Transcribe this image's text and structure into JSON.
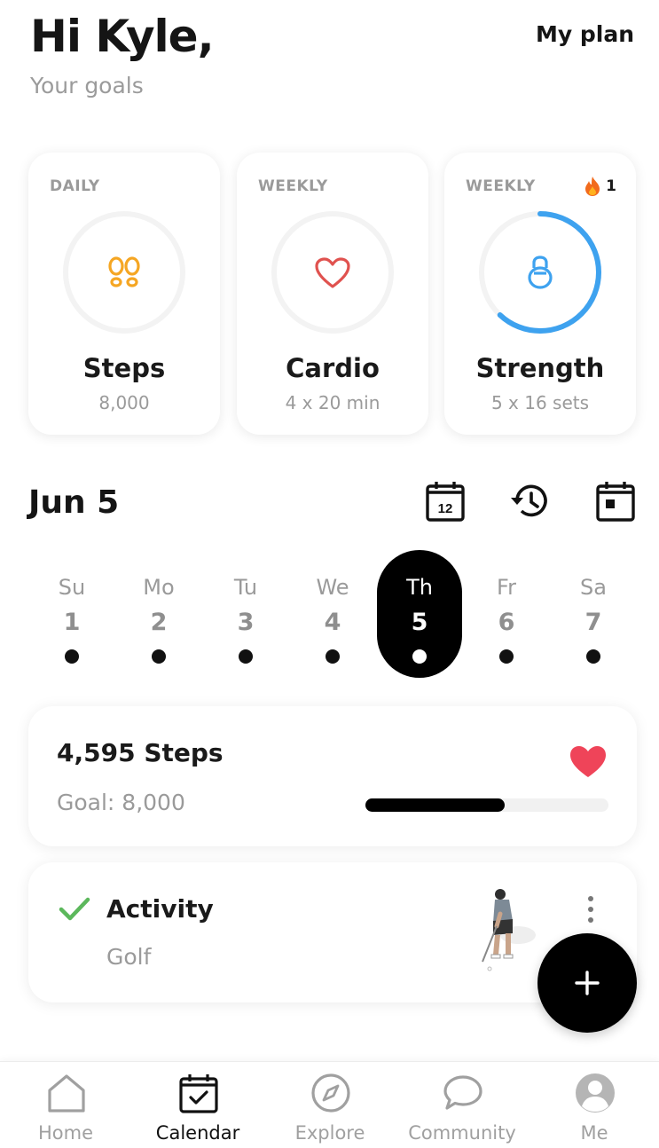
{
  "header": {
    "greeting": "Hi Kyle,",
    "subtitle": "Your goals",
    "my_plan_label": "My plan"
  },
  "goals": [
    {
      "period": "DAILY",
      "name": "Steps",
      "target": "8,000",
      "icon": "footprints-icon",
      "progress": 0
    },
    {
      "period": "WEEKLY",
      "name": "Cardio",
      "target": "4 x 20 min",
      "icon": "heart-icon",
      "progress": 0
    },
    {
      "period": "WEEKLY",
      "name": "Strength",
      "target": "5 x 16 sets",
      "icon": "kettlebell-icon",
      "progress": 0.62,
      "streak": "1"
    }
  ],
  "calendar": {
    "date_label": "Jun 5",
    "calendar_icon_number": "12",
    "days": [
      {
        "name": "Su",
        "num": "1"
      },
      {
        "name": "Mo",
        "num": "2"
      },
      {
        "name": "Tu",
        "num": "3"
      },
      {
        "name": "We",
        "num": "4"
      },
      {
        "name": "Th",
        "num": "5",
        "active": true
      },
      {
        "name": "Fr",
        "num": "6"
      },
      {
        "name": "Sa",
        "num": "7"
      }
    ]
  },
  "steps_card": {
    "title": "4,595 Steps",
    "goal": "Goal: 8,000",
    "progress": 0.574
  },
  "activity_card": {
    "title": "Activity",
    "subtitle": "Golf"
  },
  "colors": {
    "accent_blue": "#3ea2ef",
    "steps_orange": "#f5a623",
    "cardio_red": "#e0524f",
    "heart_red": "#ef4459",
    "check_green": "#5cb85c"
  },
  "tabs": [
    {
      "label": "Home",
      "icon": "home-icon"
    },
    {
      "label": "Calendar",
      "icon": "calendar-icon",
      "active": true
    },
    {
      "label": "Explore",
      "icon": "compass-icon"
    },
    {
      "label": "Community",
      "icon": "chat-bubble-icon"
    },
    {
      "label": "Me",
      "icon": "profile-icon"
    }
  ]
}
